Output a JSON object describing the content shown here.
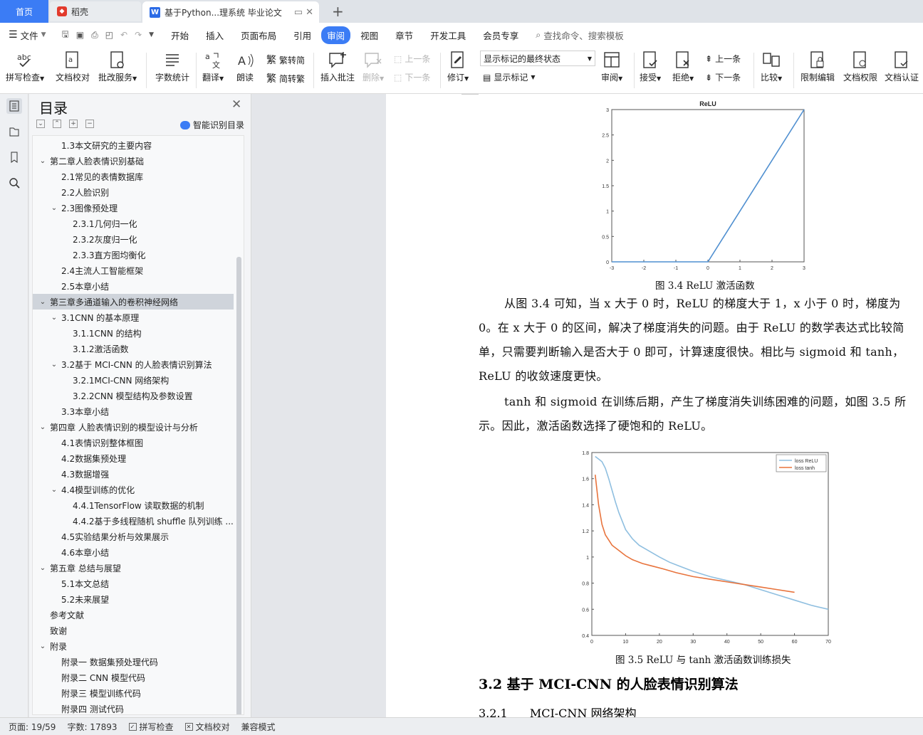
{
  "tabs": {
    "home": "首页",
    "daoke": "稻壳",
    "doc": "基于Python...理系统 毕业论文",
    "new": "+"
  },
  "menu": {
    "file": "文件",
    "items": [
      "开始",
      "插入",
      "页面布局",
      "引用",
      "审阅",
      "视图",
      "章节",
      "开发工具",
      "会员专享"
    ],
    "active_index": 4,
    "search_placeholder": "查找命令、搜索模板"
  },
  "ribbon": {
    "spell_check": "拼写检查",
    "doc_proof": "文档校对",
    "batch_service": "批改服务",
    "word_count": "字数统计",
    "translate": "翻译",
    "read_aloud": "朗读",
    "to_traditional": "繁转简",
    "to_simplified": "简转繁",
    "insert_comment": "插入批注",
    "delete": "删除",
    "prev": "上一条",
    "next": "下一条",
    "revise": "修订",
    "markup_state": "显示标记的最终状态",
    "show_markup": "显示标记",
    "review": "审阅",
    "accept": "接受",
    "reject": "拒绝",
    "prev2": "上一条",
    "next2": "下一条",
    "compare": "比较",
    "restrict_edit": "限制编辑",
    "doc_permission": "文档权限",
    "doc_cert": "文档认证"
  },
  "toc": {
    "title": "目录",
    "smart": "智能识别目录",
    "items": [
      {
        "text": "1.3本文研究的主要内容",
        "level": 2
      },
      {
        "text": "第二章人脸表情识别基础",
        "level": 1,
        "chev": true
      },
      {
        "text": "2.1常见的表情数据库",
        "level": 2
      },
      {
        "text": "2.2人脸识别",
        "level": 2
      },
      {
        "text": "2.3图像预处理",
        "level": 2,
        "chev": true
      },
      {
        "text": "2.3.1几何归一化",
        "level": 3
      },
      {
        "text": "2.3.2灰度归一化",
        "level": 3
      },
      {
        "text": "2.3.3直方图均衡化",
        "level": 3
      },
      {
        "text": "2.4主流人工智能框架",
        "level": 2
      },
      {
        "text": "2.5本章小结",
        "level": 2
      },
      {
        "text": "第三章多通道输入的卷积神经网络",
        "level": 1,
        "chev": true,
        "selected": true
      },
      {
        "text": "3.1CNN 的基本原理",
        "level": 2,
        "chev": true
      },
      {
        "text": "3.1.1CNN 的结构",
        "level": 3
      },
      {
        "text": "3.1.2激活函数",
        "level": 3
      },
      {
        "text": "3.2基于 MCI-CNN 的人脸表情识别算法",
        "level": 2,
        "chev": true
      },
      {
        "text": "3.2.1MCI-CNN 网络架构",
        "level": 3
      },
      {
        "text": "3.2.2CNN 模型结构及参数设置",
        "level": 3
      },
      {
        "text": "3.3本章小结",
        "level": 2
      },
      {
        "text": "第四章  人脸表情识别的模型设计与分析",
        "level": 1,
        "chev": true
      },
      {
        "text": "4.1表情识别整体框图",
        "level": 2
      },
      {
        "text": "4.2数据集预处理",
        "level": 2
      },
      {
        "text": "4.3数据增强",
        "level": 2
      },
      {
        "text": "4.4模型训练的优化",
        "level": 2,
        "chev": true
      },
      {
        "text": "4.4.1TensorFlow 读取数据的机制",
        "level": 3
      },
      {
        "text": "4.4.2基于多线程随机 shuffle 队列训练 ...",
        "level": 3
      },
      {
        "text": "4.5实验结果分析与效果展示",
        "level": 2
      },
      {
        "text": "4.6本章小结",
        "level": 2
      },
      {
        "text": "第五章  总结与展望",
        "level": 1,
        "chev": true
      },
      {
        "text": "5.1本文总结",
        "level": 2
      },
      {
        "text": "5.2未来展望",
        "level": 2
      },
      {
        "text": "参考文献",
        "level": 1
      },
      {
        "text": "致谢",
        "level": 1
      },
      {
        "text": "附录",
        "level": 1,
        "chev": true
      },
      {
        "text": "附录一  数据集预处理代码",
        "level": 2
      },
      {
        "text": "附录二  CNN 模型代码",
        "level": 2
      },
      {
        "text": "附录三  模型训练代码",
        "level": 2
      },
      {
        "text": "附录四  测试代码",
        "level": 2
      }
    ]
  },
  "doc": {
    "fig34_caption": "图 3.4 ReLU 激活函数",
    "para1": "从图 3.4 可知，当 x 大于 0 时，ReLU 的梯度大于 1，x 小于 0 时，梯度为 0。在 x 大于 0 的区间，解决了梯度消失的问题。由于 ReLU 的数学表达式比较简单，只需要判断输入是否大于 0 即可，计算速度很快。相比与 sigmoid 和 tanh，ReLU 的收敛速度更快。",
    "para2": "tanh 和 sigmoid 在训练后期，产生了梯度消失训练困难的问题，如图 3.5 所示。因此，激活函数选择了硬饱和的 ReLU。",
    "fig35_caption": "图 3.5 ReLU 与 tanh 激活函数训练损失",
    "heading_32": "3.2 基于 MCI-CNN 的人脸表情识别算法",
    "heading_321_num": "3.2.1",
    "heading_321_text": "MCI-CNN 网络架构"
  },
  "chart_data": [
    {
      "type": "line",
      "title": "ReLU",
      "xlim": [
        -3,
        3
      ],
      "ylim": [
        0,
        3
      ],
      "xticks": [
        -3,
        -2,
        -1,
        0,
        1,
        2,
        3
      ],
      "yticks": [
        0,
        0.5,
        1,
        1.5,
        2,
        2.5,
        3
      ],
      "series": [
        {
          "x": [
            -3,
            0,
            3
          ],
          "y": [
            0,
            0,
            3
          ],
          "color": "#4f8fd0"
        }
      ]
    },
    {
      "type": "line",
      "xlim": [
        0,
        70
      ],
      "ylim": [
        0.4,
        1.8
      ],
      "xticks": [
        0,
        10,
        20,
        30,
        40,
        50,
        60,
        70
      ],
      "yticks": [
        0.4,
        0.6,
        0.8,
        1,
        1.2,
        1.4,
        1.6,
        1.8
      ],
      "legend_position": "top-right",
      "series": [
        {
          "name": "loss ReLU",
          "color": "#8fbfe0",
          "x": [
            1,
            2,
            3,
            4,
            5,
            6,
            7,
            8,
            10,
            12,
            14,
            16,
            18,
            20,
            23,
            26,
            30,
            35,
            40,
            45,
            50,
            55,
            60,
            65,
            70
          ],
          "y": [
            1.77,
            1.75,
            1.73,
            1.68,
            1.6,
            1.51,
            1.42,
            1.34,
            1.21,
            1.14,
            1.09,
            1.06,
            1.03,
            1.0,
            0.96,
            0.93,
            0.89,
            0.85,
            0.82,
            0.79,
            0.75,
            0.71,
            0.67,
            0.63,
            0.6
          ]
        },
        {
          "name": "loss tanh",
          "color": "#e8733c",
          "x": [
            1,
            2,
            3,
            4,
            5,
            6,
            8,
            10,
            12,
            15,
            18,
            21,
            25,
            30,
            35,
            40,
            45,
            50,
            55,
            60
          ],
          "y": [
            1.63,
            1.4,
            1.25,
            1.17,
            1.13,
            1.09,
            1.05,
            1.01,
            0.98,
            0.95,
            0.93,
            0.91,
            0.88,
            0.85,
            0.83,
            0.81,
            0.79,
            0.77,
            0.75,
            0.73
          ]
        }
      ]
    }
  ],
  "status": {
    "page": "页面: 19/59",
    "words": "字数: 17893",
    "spell": "拼写检查",
    "proof": "文档校对",
    "compat": "兼容模式"
  }
}
